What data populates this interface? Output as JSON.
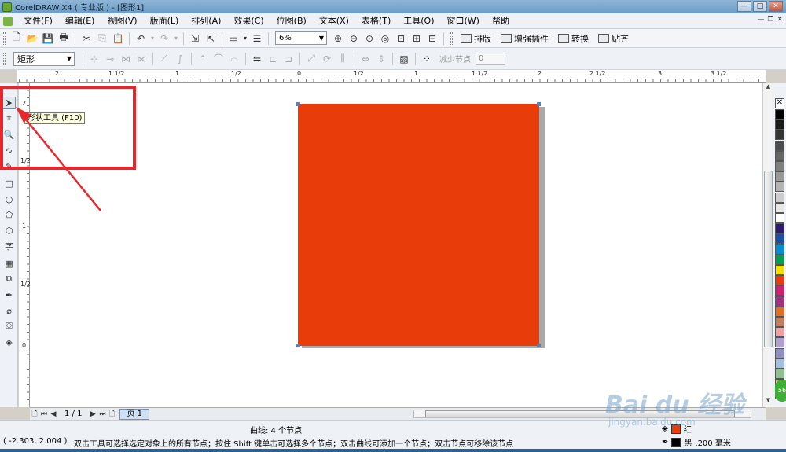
{
  "window": {
    "title": "CorelDRAW X4 ( 专业版 ) - [图形1]",
    "buttons": [
      "—",
      "□",
      "✕"
    ]
  },
  "menu": {
    "items": [
      "文件(F)",
      "编辑(E)",
      "视图(V)",
      "版面(L)",
      "排列(A)",
      "效果(C)",
      "位图(B)",
      "文本(X)",
      "表格(T)",
      "工具(O)",
      "窗口(W)",
      "帮助"
    ]
  },
  "toolbar": {
    "zoom_value": "6%",
    "layout_label": "排版",
    "enhance_label": "增强插件",
    "convert_label": "转换",
    "align_label": "贴齐"
  },
  "property_bar": {
    "shape_type": "矩形",
    "reduce_nodes_label": "减少节点",
    "reduce_nodes_value": "0"
  },
  "rulers": {
    "top_labels": [
      "2",
      "1 1/2",
      "1",
      "1/2",
      "0",
      "1/2",
      "1",
      "1 1/2",
      "2",
      "2 1/2",
      "3",
      "3 1/2"
    ],
    "left_labels": [
      "2",
      "1/2",
      "1",
      "1/2",
      "0"
    ]
  },
  "tooltip": {
    "text": "形状工具 (F10)"
  },
  "pagebar": {
    "page_count": "1 / 1",
    "page_tab": "页 1"
  },
  "status": {
    "object_info": "曲线:  4 个节点",
    "coordinates": "( -2.303, 2.004 )",
    "hint": "双击工具可选择选定对象上的所有节点；按住 Shift 键单击可选择多个节点；双击曲线可添加一个节点；双击节点可移除该节点",
    "fill_name": "红",
    "fill_color": "#e83c0a",
    "outline_name": "黑",
    "outline_width": ".200 毫米"
  },
  "colors": {
    "shape_fill": "#e83c0a",
    "highlight": "#e8262e"
  },
  "palette": {
    "swatches": [
      "#000000",
      "#1a1a1a",
      "#333333",
      "#4d4d4d",
      "#666666",
      "#808080",
      "#999999",
      "#b3b3b3",
      "#cccccc",
      "#e6e6e6",
      "#ffffff",
      "#2e1a6e",
      "#1f4fa0",
      "#0090d0",
      "#00a050",
      "#f0e000",
      "#e83c0a",
      "#d02070",
      "#a03080",
      "#e07020",
      "#c08060",
      "#f0a0a0",
      "#b0a0d0",
      "#9090c0",
      "#a0c0e0",
      "#90c090",
      "#d0d080",
      "#c0c0c0"
    ]
  },
  "watermark": {
    "text": "Bai du 经验",
    "sub": "jingyan.baidu.com",
    "badge": "56"
  }
}
